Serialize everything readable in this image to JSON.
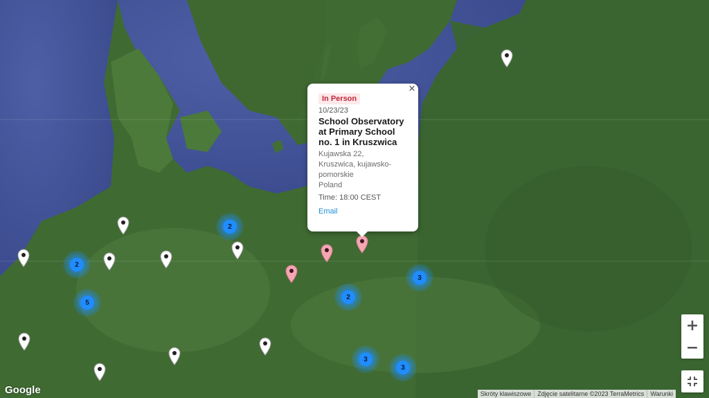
{
  "map": {
    "brand": "Google",
    "attribution": {
      "keyboard_shortcuts": "Skróty klawiszowe",
      "imagery": "Zdjęcie satelitarne ©2023 TerraMetrics",
      "terms": "Warunki"
    },
    "zoom_in_label": "+",
    "zoom_out_label": "−",
    "colors": {
      "cluster": "#1f8cff",
      "pin_default": "#ffffff",
      "pin_in_person": "#f6a5b2",
      "accent_badge": "#c0283a",
      "link": "#1a8fd1"
    }
  },
  "popup": {
    "badge": "In Person",
    "date": "10/23/23",
    "title": "School Observatory at Primary School no. 1 in Kruszwica",
    "address_line1": "Kujawska 22,",
    "address_line2": "Kruszwica, kujawsko-pomorskie",
    "country": "Poland",
    "time": "Time: 18:00 CEST",
    "email_link": "Email",
    "close_icon": "×"
  },
  "clusters": [
    {
      "count": "2"
    },
    {
      "count": "2"
    },
    {
      "count": "5"
    },
    {
      "count": "2"
    },
    {
      "count": "3"
    },
    {
      "count": "3"
    },
    {
      "count": "3"
    }
  ],
  "pins": [
    {
      "type": "event"
    },
    {
      "type": "event"
    },
    {
      "type": "event"
    },
    {
      "type": "event"
    },
    {
      "type": "event"
    },
    {
      "type": "event"
    },
    {
      "type": "event"
    },
    {
      "type": "event"
    },
    {
      "type": "event"
    },
    {
      "type": "event"
    },
    {
      "type": "in-person"
    },
    {
      "type": "in-person"
    },
    {
      "type": "in-person"
    }
  ]
}
